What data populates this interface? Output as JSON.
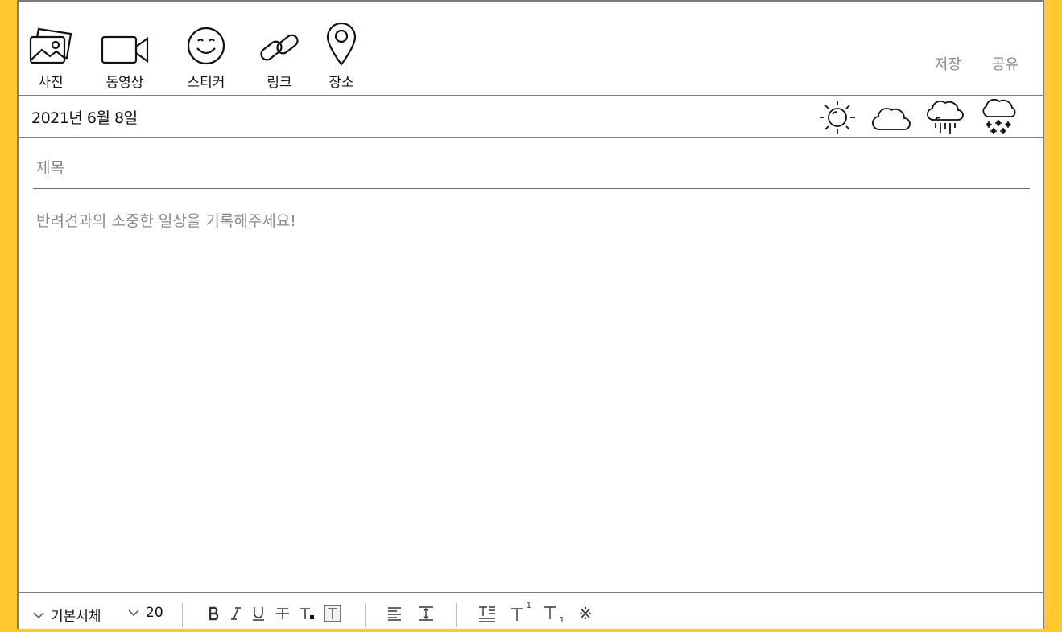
{
  "toolbar": {
    "tools": [
      {
        "label": "사진",
        "icon": "photo-icon"
      },
      {
        "label": "동영상",
        "icon": "video-icon"
      },
      {
        "label": "스티커",
        "icon": "smile-icon"
      },
      {
        "label": "링크",
        "icon": "link-icon"
      },
      {
        "label": "장소",
        "icon": "location-pin-icon"
      }
    ],
    "save_label": "저장",
    "share_label": "공유"
  },
  "date": "2021년 6월 8일",
  "weather": [
    "sun-icon",
    "cloud-icon",
    "rain-icon",
    "snow-icon"
  ],
  "title_placeholder": "제목",
  "body_placeholder": "반려견과의 소중한 일상을 기록해주세요!",
  "format": {
    "font_family": "기본서체",
    "font_size": "20",
    "superscript_mark": "1",
    "subscript_mark": "1",
    "special_char": "※"
  },
  "colors": {
    "background": "#fec92f",
    "border": "#7d7d7d",
    "muted_text": "#8a8a8a"
  }
}
